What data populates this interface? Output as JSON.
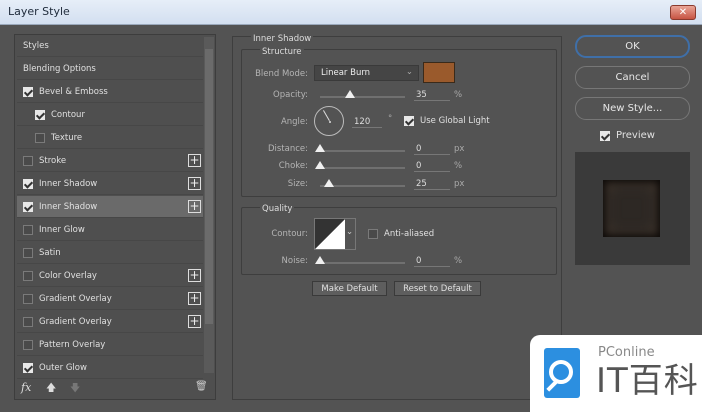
{
  "window": {
    "title": "Layer Style",
    "close": "✕"
  },
  "sidebar": {
    "items": [
      {
        "label": "Styles",
        "checkbox": null,
        "indent": 0,
        "plus": false
      },
      {
        "label": "Blending Options",
        "checkbox": null,
        "indent": 0,
        "plus": false
      },
      {
        "label": "Bevel & Emboss",
        "checkbox": true,
        "indent": 0,
        "plus": false
      },
      {
        "label": "Contour",
        "checkbox": true,
        "indent": 1,
        "plus": false
      },
      {
        "label": "Texture",
        "checkbox": false,
        "indent": 1,
        "plus": false
      },
      {
        "label": "Stroke",
        "checkbox": false,
        "indent": 0,
        "plus": true
      },
      {
        "label": "Inner Shadow",
        "checkbox": true,
        "indent": 0,
        "plus": true
      },
      {
        "label": "Inner Shadow",
        "checkbox": true,
        "indent": 0,
        "plus": true,
        "selected": true
      },
      {
        "label": "Inner Glow",
        "checkbox": false,
        "indent": 0,
        "plus": false
      },
      {
        "label": "Satin",
        "checkbox": false,
        "indent": 0,
        "plus": false
      },
      {
        "label": "Color Overlay",
        "checkbox": false,
        "indent": 0,
        "plus": true
      },
      {
        "label": "Gradient Overlay",
        "checkbox": false,
        "indent": 0,
        "plus": true
      },
      {
        "label": "Gradient Overlay",
        "checkbox": false,
        "indent": 0,
        "plus": true
      },
      {
        "label": "Pattern Overlay",
        "checkbox": false,
        "indent": 0,
        "plus": false
      },
      {
        "label": "Outer Glow",
        "checkbox": true,
        "indent": 0,
        "plus": false
      }
    ],
    "toolbar": {
      "fx": "fx",
      "up": "🡅",
      "down": "🡇",
      "trash": "🗑"
    }
  },
  "panel": {
    "section_title": "Inner Shadow",
    "structure": {
      "title": "Structure",
      "blend_mode_label": "Blend Mode:",
      "blend_mode": "Linear Burn",
      "color": "#9a5a2c",
      "opacity_label": "Opacity:",
      "opacity": "35",
      "opacity_unit": "%",
      "angle_label": "Angle:",
      "angle": "120",
      "angle_unit": "°",
      "use_global_light": "Use Global Light",
      "use_global_light_checked": true,
      "distance_label": "Distance:",
      "distance": "0",
      "distance_unit": "px",
      "choke_label": "Choke:",
      "choke": "0",
      "choke_unit": "%",
      "size_label": "Size:",
      "size": "25",
      "size_unit": "px"
    },
    "quality": {
      "title": "Quality",
      "contour_label": "Contour:",
      "anti_aliased": "Anti-aliased",
      "anti_aliased_checked": false,
      "noise_label": "Noise:",
      "noise": "0",
      "noise_unit": "%"
    },
    "make_default": "Make Default",
    "reset_default": "Reset to Default"
  },
  "actions": {
    "ok": "OK",
    "cancel": "Cancel",
    "new_style": "New Style...",
    "preview": "Preview",
    "preview_checked": true
  },
  "watermark": {
    "brand": "PConline",
    "name": "IT百科",
    "accent": "#2c8fe0"
  }
}
